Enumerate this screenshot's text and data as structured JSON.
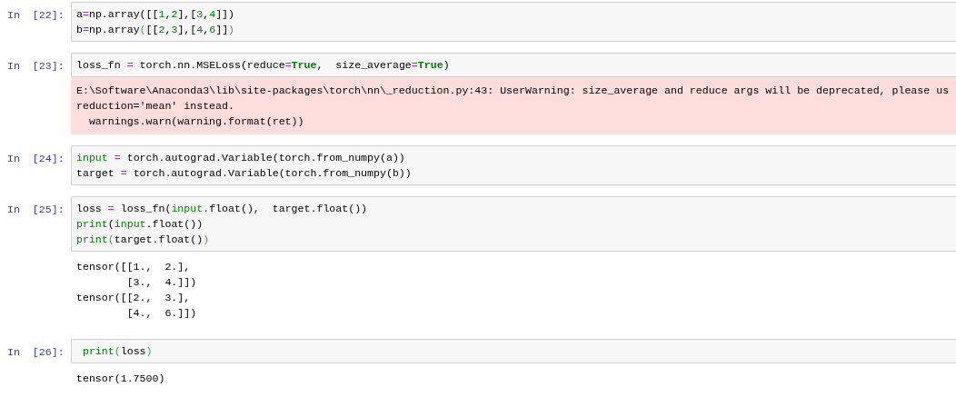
{
  "cells": [
    {
      "prompt": "In  [22]:",
      "code": [
        [
          {
            "t": "a",
            "kind": "plain"
          },
          {
            "t": "=",
            "kind": "operator"
          },
          {
            "t": "np.array([[",
            "kind": "plain"
          },
          {
            "t": "1",
            "kind": "number"
          },
          {
            "t": ",",
            "kind": "plain"
          },
          {
            "t": "2",
            "kind": "number"
          },
          {
            "t": "],[",
            "kind": "plain"
          },
          {
            "t": "3",
            "kind": "number"
          },
          {
            "t": ",",
            "kind": "plain"
          },
          {
            "t": "4",
            "kind": "number"
          },
          {
            "t": "]])",
            "kind": "plain"
          }
        ],
        [
          {
            "t": "b",
            "kind": "plain"
          },
          {
            "t": "=",
            "kind": "operator"
          },
          {
            "t": "np.array",
            "kind": "plain"
          },
          {
            "t": "(",
            "kind": "match"
          },
          {
            "t": "[[",
            "kind": "plain"
          },
          {
            "t": "2",
            "kind": "number"
          },
          {
            "t": ",",
            "kind": "plain"
          },
          {
            "t": "3",
            "kind": "number"
          },
          {
            "t": "],[",
            "kind": "plain"
          },
          {
            "t": "4",
            "kind": "number"
          },
          {
            "t": ",",
            "kind": "plain"
          },
          {
            "t": "6",
            "kind": "number"
          },
          {
            "t": "]]",
            "kind": "plain"
          },
          {
            "t": ")",
            "kind": "match"
          }
        ]
      ]
    },
    {
      "prompt": "In  [23]:",
      "code": [
        [
          {
            "t": "loss_fn ",
            "kind": "plain"
          },
          {
            "t": "=",
            "kind": "operator"
          },
          {
            "t": " torch.nn.MSELoss(reduce",
            "kind": "plain"
          },
          {
            "t": "=",
            "kind": "operator"
          },
          {
            "t": "True",
            "kind": "keyword"
          },
          {
            "t": ",  size_average",
            "kind": "plain"
          },
          {
            "t": "=",
            "kind": "operator"
          },
          {
            "t": "True",
            "kind": "keyword"
          },
          {
            "t": ")",
            "kind": "plain"
          }
        ]
      ],
      "outputs": [
        {
          "kind": "stderr",
          "lines": [
            "E:\\Software\\Anaconda3\\lib\\site-packages\\torch\\nn\\_reduction.py:43: UserWarning: size_average and reduce args will be deprecated, please us",
            "reduction='mean' instead.",
            "  warnings.warn(warning.format(ret))"
          ]
        }
      ]
    },
    {
      "prompt": "In  [24]:",
      "code": [
        [
          {
            "t": "input",
            "kind": "builtin"
          },
          {
            "t": " =",
            "kind": "operator"
          },
          {
            "t": " torch.autograd.Variable(torch.from_numpy(a))",
            "kind": "plain"
          }
        ],
        [
          {
            "t": "target ",
            "kind": "plain"
          },
          {
            "t": "=",
            "kind": "operator"
          },
          {
            "t": " torch.autograd.Variable(torch.from_numpy(b))",
            "kind": "plain"
          }
        ]
      ]
    },
    {
      "prompt": "In  [25]:",
      "code": [
        [
          {
            "t": "loss ",
            "kind": "plain"
          },
          {
            "t": "=",
            "kind": "operator"
          },
          {
            "t": " loss_fn(",
            "kind": "plain"
          },
          {
            "t": "input",
            "kind": "builtin"
          },
          {
            "t": ".float(),  target.float())",
            "kind": "plain"
          }
        ],
        [
          {
            "t": "print",
            "kind": "builtin"
          },
          {
            "t": "(",
            "kind": "plain"
          },
          {
            "t": "input",
            "kind": "builtin"
          },
          {
            "t": ".float())",
            "kind": "plain"
          }
        ],
        [
          {
            "t": "print",
            "kind": "builtin"
          },
          {
            "t": "(",
            "kind": "match"
          },
          {
            "t": "target.float()",
            "kind": "plain"
          },
          {
            "t": ")",
            "kind": "match"
          }
        ]
      ],
      "outputs": [
        {
          "kind": "stream",
          "lines": [
            "tensor([[1.,  2.],",
            "        [3.,  4.]])",
            "tensor([[2.,  3.],",
            "        [4.,  6.]])"
          ]
        }
      ]
    },
    {
      "prompt": "In  [26]:",
      "code": [
        [
          {
            "t": " print",
            "kind": "builtin"
          },
          {
            "t": "(",
            "kind": "match"
          },
          {
            "t": "loss",
            "kind": "plain"
          },
          {
            "t": ")",
            "kind": "match"
          }
        ]
      ],
      "outputs": [
        {
          "kind": "stream",
          "lines": [
            "tensor(1.7500)"
          ]
        }
      ]
    }
  ]
}
